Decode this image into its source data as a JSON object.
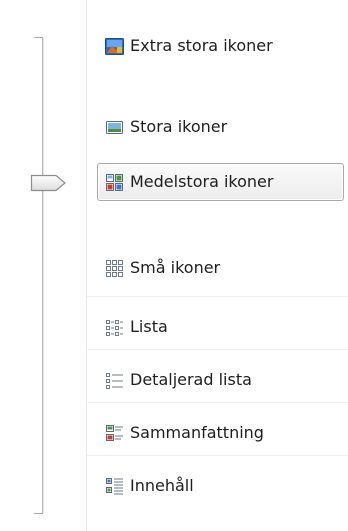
{
  "view_menu": {
    "items": [
      {
        "label": "Extra stora ikoner",
        "icon": "extra-large-icons-icon"
      },
      {
        "label": "Stora ikoner",
        "icon": "large-icons-icon"
      },
      {
        "label": "Medelstora ikoner",
        "icon": "medium-icons-icon",
        "selected": true
      },
      {
        "label": "Små ikoner",
        "icon": "small-icons-icon"
      },
      {
        "label": "Lista",
        "icon": "list-icon"
      },
      {
        "label": "Detaljerad lista",
        "icon": "details-icon"
      },
      {
        "label": "Sammanfattning",
        "icon": "tiles-icon"
      },
      {
        "label": "Innehåll",
        "icon": "content-icon"
      }
    ]
  },
  "colors": {
    "accent": "#3b78c9",
    "border": "#a8a8a8"
  }
}
